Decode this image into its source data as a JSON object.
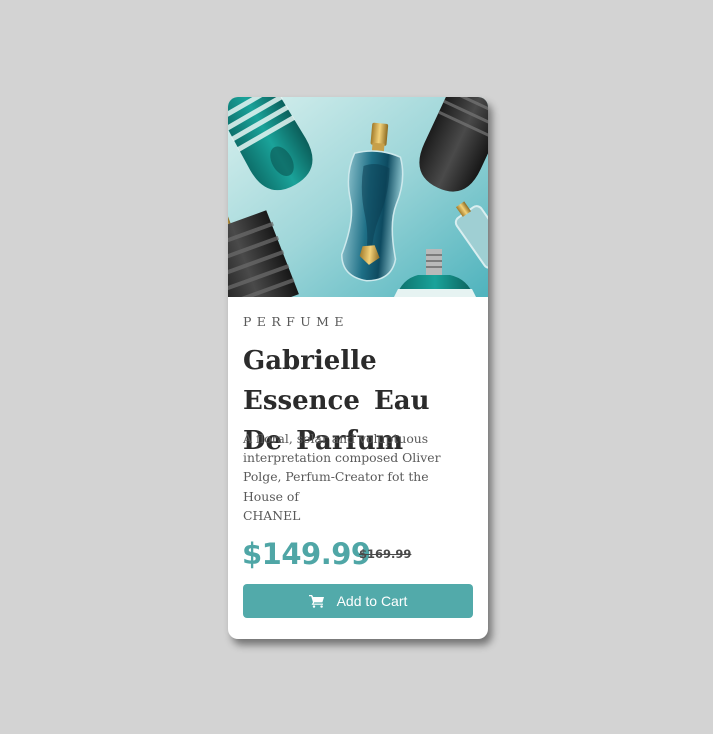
{
  "product": {
    "category": "PERFUME",
    "title": "Gabrielle Essence Eau De Parfum",
    "description_lines": [
      "A floral, solar and voluptuous",
      "interpretation composed Oliver",
      "Polge, Perfum-Creator fot the",
      "House of",
      "CHANEL"
    ],
    "price": "$149.99",
    "old_price": "$169.99",
    "image_alt": "Perfume bottles on teal background"
  },
  "actions": {
    "add_to_cart_label": "Add to Cart",
    "add_to_cart_icon": "cart-icon"
  },
  "colors": {
    "page_background": "#d3d3d3",
    "accent": "#52aaaa",
    "price": "#4fa6a6",
    "title": "#2b2b2b",
    "text": "#595959"
  }
}
